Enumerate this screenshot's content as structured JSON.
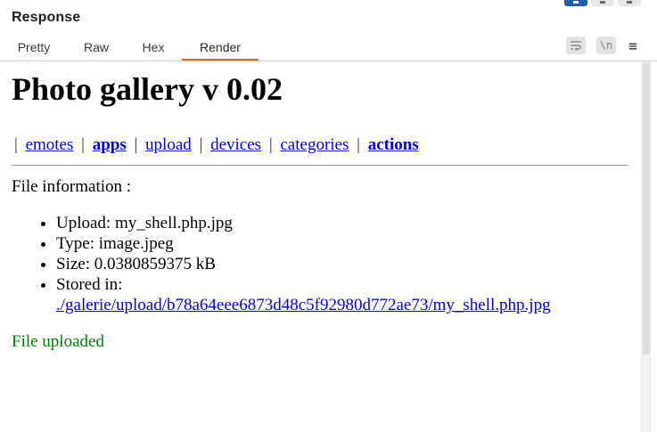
{
  "panel": {
    "title": "Response",
    "tabs": [
      {
        "label": "Pretty"
      },
      {
        "label": "Raw"
      },
      {
        "label": "Hex"
      },
      {
        "label": "Render"
      }
    ],
    "active_tab": "Render",
    "tools": {
      "wrap_icon": "wrap-lines-icon",
      "newline_icon_text": "\\n",
      "menu_icon": "≡"
    },
    "accent_color": "#f05a28"
  },
  "page": {
    "heading": "Photo gallery v 0.02",
    "nav_links": [
      {
        "label": "emotes"
      },
      {
        "label": "apps"
      },
      {
        "label": "upload"
      },
      {
        "label": "devices"
      },
      {
        "label": "categories"
      },
      {
        "label": "actions"
      }
    ],
    "file_info_label": "File information :",
    "file_info": {
      "upload": "Upload: my_shell.php.jpg",
      "type": "Type: image.jpeg",
      "size": "Size: 0.0380859375 kB",
      "stored_in_label": "Stored in:",
      "stored_in_link": "./galerie/upload/b78a64eee6873d48c5f92980d772ae73/my_shell.php.jpg"
    },
    "status": "File uploaded",
    "status_color": "#008000"
  }
}
